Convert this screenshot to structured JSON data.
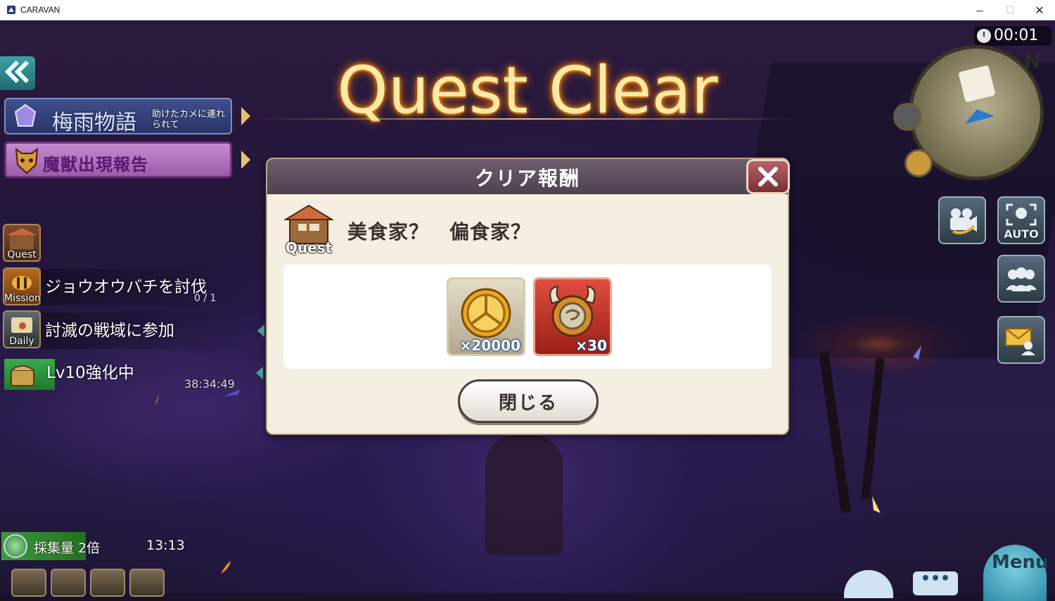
{
  "window": {
    "title": "CARAVAN",
    "minimize_glyph": "─",
    "maximize_glyph": "☐",
    "close_glyph": "✕"
  },
  "banner": {
    "heading": "Quest Clear"
  },
  "hud": {
    "clock": "00:01",
    "compass": "N",
    "event": {
      "title": "梅雨物語",
      "subtitle": "助けたカメに連れられて"
    },
    "report_label": "魔獣出現報告",
    "sidebar": {
      "quest_caption": "Quest",
      "mission_caption": "Mission",
      "daily_caption": "Daily"
    },
    "mission": {
      "label": "ジョウオウバチを討伐",
      "progress": "0 / 1"
    },
    "daily": {
      "label": "討滅の戦域に参加"
    },
    "upgrade": {
      "label": "Lv10強化中",
      "timer": "38:34:49"
    },
    "gather": {
      "label": "採集量 2倍",
      "timer": "13:13"
    },
    "right_buttons": {
      "auto_label": "AUTO"
    },
    "menu_label": "Menu",
    "dots_label": "•••"
  },
  "modal": {
    "title": "クリア報酬",
    "quest_caption": "Quest",
    "quest_title": "美食家？　偏食家？",
    "rewards": [
      {
        "icon": "gold-coin-icon",
        "count": "×20000"
      },
      {
        "icon": "horned-orb-icon",
        "count": "×30"
      }
    ],
    "close_button": "閉じる"
  },
  "colors": {
    "heading_glow": "#ff9a1a",
    "modal_bg": "#f5efe1",
    "modal_header": "#5e4f5e",
    "close_accent": "#9a3f45"
  }
}
